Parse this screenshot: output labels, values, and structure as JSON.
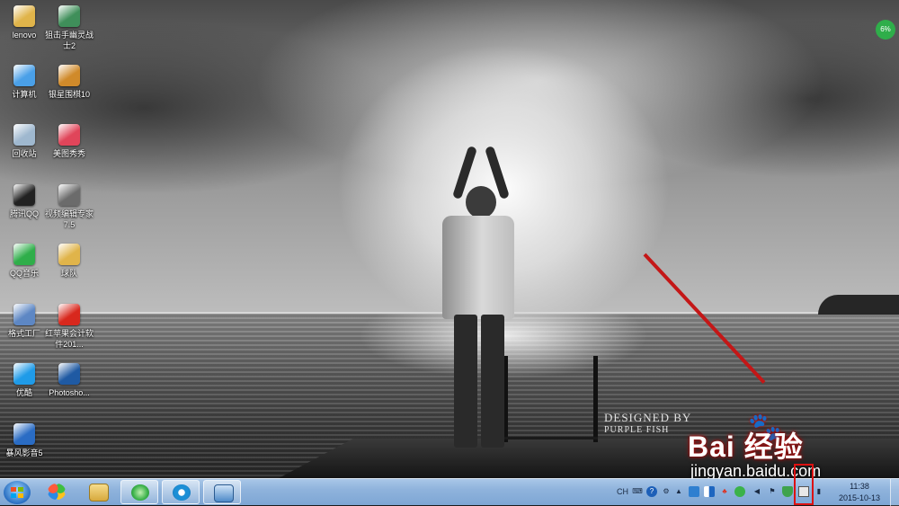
{
  "desktop_icons": [
    {
      "label": "lenovo",
      "icon": "folder-icon",
      "color": "#e0b44a"
    },
    {
      "label": "狙击手幽灵战士2",
      "icon": "game-icon",
      "color": "#3f8f5a"
    },
    {
      "label": "计算机",
      "icon": "computer-icon",
      "color": "#4aa0e8"
    },
    {
      "label": "银星围棋10",
      "icon": "go-game-icon",
      "color": "#d08a2a"
    },
    {
      "label": "回收站",
      "icon": "recycle-bin-icon",
      "color": "#9fb8cf"
    },
    {
      "label": "美图秀秀",
      "icon": "meitu-icon",
      "color": "#e0455a"
    },
    {
      "label": "腾讯QQ",
      "icon": "qq-penguin-icon",
      "color": "#222222"
    },
    {
      "label": "视频编辑专家 7.5",
      "icon": "video-editor-icon",
      "color": "#6b6b6b"
    },
    {
      "label": "QQ音乐",
      "icon": "qq-music-icon",
      "color": "#2fae4a"
    },
    {
      "label": "球队",
      "icon": "folder-icon",
      "color": "#e0b44a"
    },
    {
      "label": "格式工厂",
      "icon": "format-factory-icon",
      "color": "#5d87c4"
    },
    {
      "label": "红苹果会计软件201...",
      "icon": "red-apple-icon",
      "color": "#d8281d"
    },
    {
      "label": "优酷",
      "icon": "youku-icon",
      "color": "#1f9be8"
    },
    {
      "label": "Photosho...",
      "icon": "photoshop-icon",
      "color": "#1f5aa3"
    },
    {
      "label": "暴风影音5",
      "icon": "storm-player-icon",
      "color": "#2a6cc4"
    }
  ],
  "corner_badge": "6%",
  "wallpaper_watermark": {
    "line1": "DESIGNED BY",
    "line2": "PURPLE FISH"
  },
  "overlay": {
    "brand": "Bai  经验",
    "url": "jingyan.baidu.com"
  },
  "taskbar": {
    "pinned": [
      {
        "name": "start-orb",
        "glyph": "windows-logo"
      },
      {
        "name": "apps-icon",
        "color": "#ffb400"
      },
      {
        "name": "explorer-icon",
        "color": "#e8c35a"
      },
      {
        "name": "360-browser-icon",
        "color": "#3bb24a"
      },
      {
        "name": "player-icon",
        "color": "#1c8fd6"
      },
      {
        "name": "remote-desktop-icon",
        "color": "#4d8ac8"
      }
    ],
    "tray_lang": "CH",
    "clock_time": "11:38",
    "clock_date": "2015-10-13"
  },
  "colors": {
    "arrow": "#c41717",
    "highlight": "#dd1111",
    "taskbar": "#8fb3dc"
  }
}
